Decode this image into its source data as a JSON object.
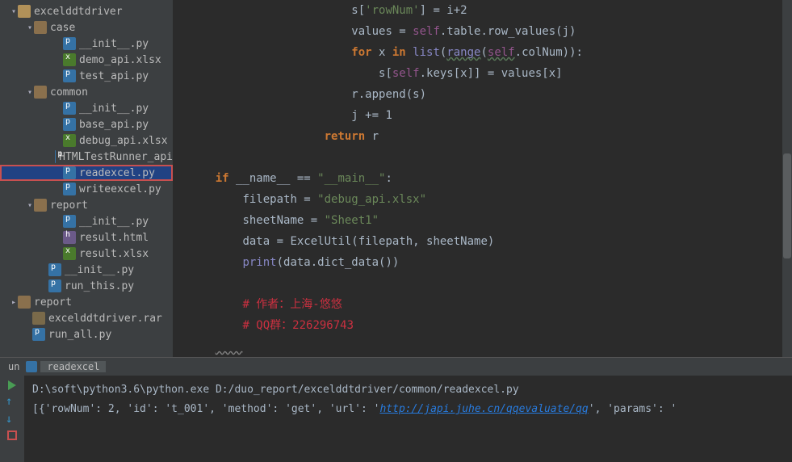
{
  "tree": [
    {
      "pad": 12,
      "arrow": "▾",
      "ic": "proj",
      "label": "excelddtdriver"
    },
    {
      "pad": 32,
      "arrow": "▾",
      "ic": "dir",
      "label": "case"
    },
    {
      "pad": 68,
      "arrow": "",
      "ic": "py",
      "label": "__init__.py"
    },
    {
      "pad": 68,
      "arrow": "",
      "ic": "xlsx",
      "label": "demo_api.xlsx"
    },
    {
      "pad": 68,
      "arrow": "",
      "ic": "py",
      "label": "test_api.py"
    },
    {
      "pad": 32,
      "arrow": "▾",
      "ic": "dir",
      "label": "common"
    },
    {
      "pad": 68,
      "arrow": "",
      "ic": "py",
      "label": "__init__.py"
    },
    {
      "pad": 68,
      "arrow": "",
      "ic": "py",
      "label": "base_api.py"
    },
    {
      "pad": 68,
      "arrow": "",
      "ic": "xlsx",
      "label": "debug_api.xlsx"
    },
    {
      "pad": 68,
      "arrow": "",
      "ic": "py",
      "label": "HTMLTestRunner_api"
    },
    {
      "pad": 68,
      "arrow": "",
      "ic": "py",
      "label": "readexcel.py",
      "sel": true
    },
    {
      "pad": 68,
      "arrow": "",
      "ic": "py",
      "label": "writeexcel.py"
    },
    {
      "pad": 32,
      "arrow": "▾",
      "ic": "dir",
      "label": "report"
    },
    {
      "pad": 68,
      "arrow": "",
      "ic": "py",
      "label": "__init__.py"
    },
    {
      "pad": 68,
      "arrow": "",
      "ic": "html",
      "label": "result.html"
    },
    {
      "pad": 68,
      "arrow": "",
      "ic": "xlsx",
      "label": "result.xlsx"
    },
    {
      "pad": 50,
      "arrow": "",
      "ic": "py",
      "label": "__init__.py"
    },
    {
      "pad": 50,
      "arrow": "",
      "ic": "py",
      "label": "run_this.py"
    },
    {
      "pad": 12,
      "arrow": "▸",
      "ic": "dir",
      "label": "report"
    },
    {
      "pad": 30,
      "arrow": "",
      "ic": "rar",
      "label": "excelddtdriver.rar"
    },
    {
      "pad": 30,
      "arrow": "",
      "ic": "py",
      "label": "run_all.py"
    }
  ],
  "code": {
    "l1_s": "s[",
    "l1_key": "'rowNum'",
    "l1_rest": "] = i+",
    "l1_num": "2",
    "l2_a": "values = ",
    "l2_self": "self",
    "l2_b": ".table.row_values(j)",
    "l3_for": "for ",
    "l3_x": "x ",
    "l3_in": "in ",
    "l3_list": "list",
    "l3_op": "(",
    "l3_range": "range",
    "l3_op2": "(",
    "l3_self": "self",
    "l3_col": ".colNum)):",
    "l4_a": "s[",
    "l4_self": "self",
    "l4_b": ".keys[x]] = values[x]",
    "l5": "r.append(s)",
    "l6_a": "j += ",
    "l6_num": "1",
    "l7_ret": "return ",
    "l7_r": "r",
    "l8_if": "if ",
    "l8_name": "__name__ == ",
    "l8_main": "\"__main__\"",
    "l8_colon": ":",
    "l9_a": "filepath = ",
    "l9_s": "\"debug_api.xlsx\"",
    "l10_a": "sheetName = ",
    "l10_s": "\"Sheet1\"",
    "l11": "data = ExcelUtil(filepath, sheetName)",
    "l12_print": "print",
    "l12_rest": "(data.dict_data())",
    "l13": "# 作者：上海-悠悠",
    "l14": "# QQ群：226296743"
  },
  "tabs": {
    "run": "un",
    "file": "readexcel"
  },
  "console": {
    "cmd": "D:\\soft\\python3.6\\python.exe D:/duo_report/excelddtdriver/common/readexcel.py",
    "pre": "[{'rowNum': 2, 'id': 't_001', 'method': 'get', 'url': '",
    "url": "http://japi.juhe.cn/qqevaluate/qq",
    "post": "', 'params': '"
  }
}
